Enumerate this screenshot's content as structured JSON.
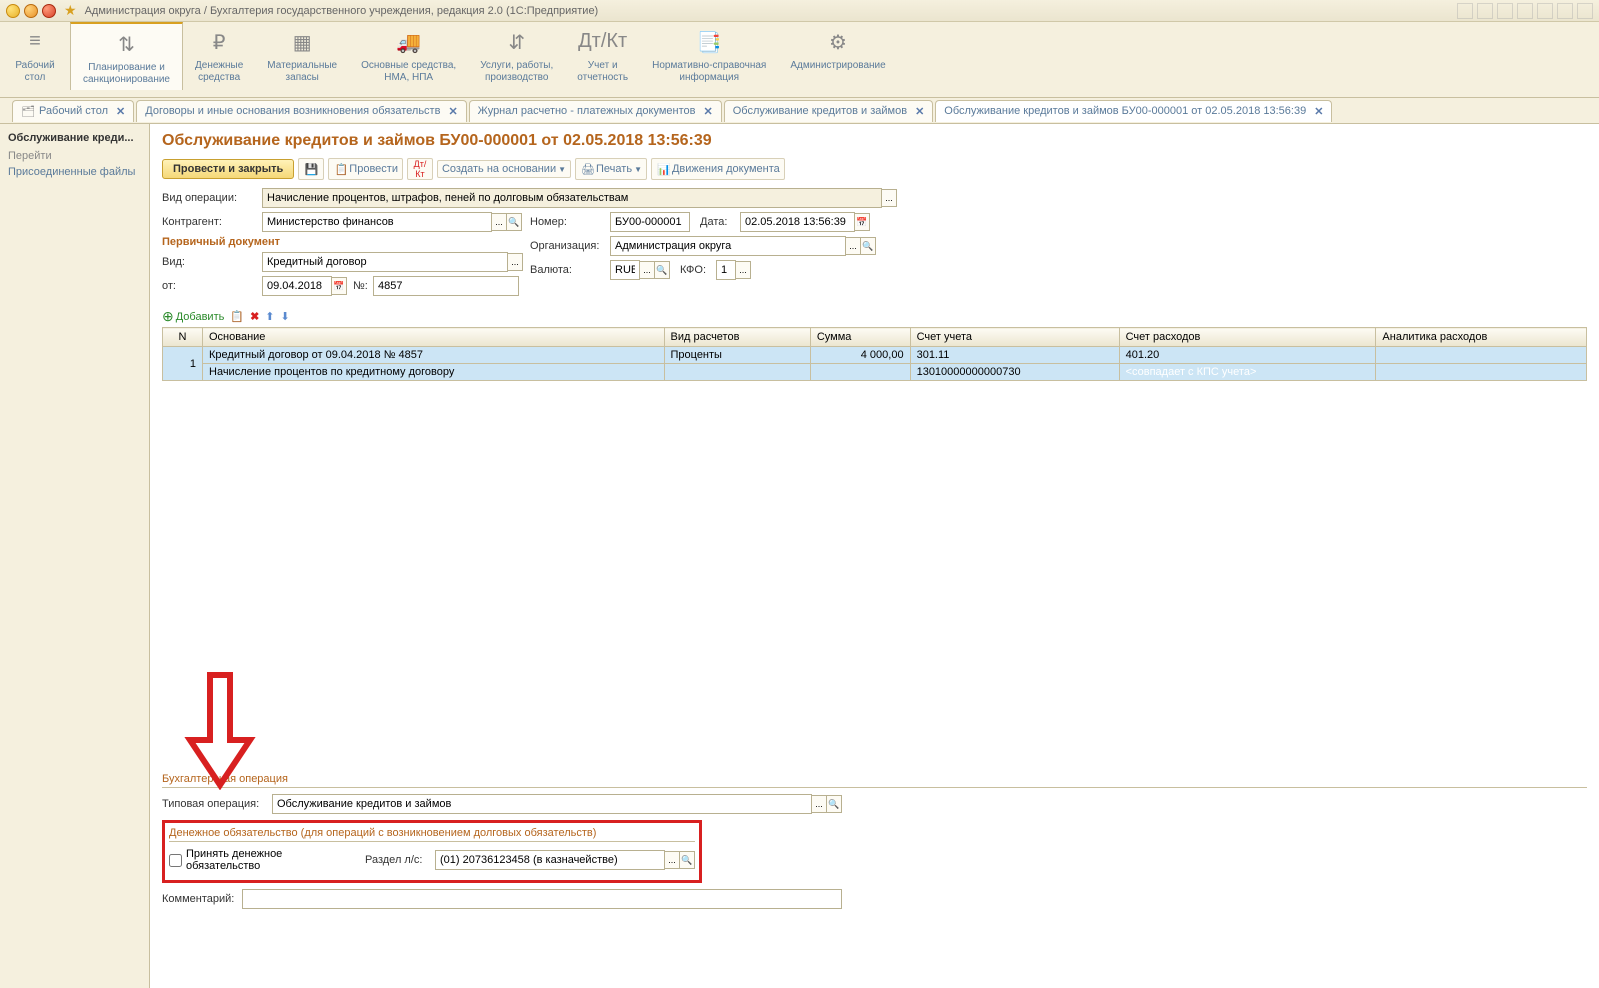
{
  "titlebar": {
    "title": "Администрация округа / Бухгалтерия государственного учреждения, редакция 2.0  (1С:Предприятие)"
  },
  "sections": [
    {
      "icon": "≡",
      "label": "Рабочий\nстол"
    },
    {
      "icon": "⇅",
      "label": "Планирование и\nсанкционирование",
      "active": true
    },
    {
      "icon": "₽",
      "label": "Денежные\nсредства"
    },
    {
      "icon": "▦",
      "label": "Материальные\nзапасы"
    },
    {
      "icon": "🚚",
      "label": "Основные средства,\nНМА, НПА"
    },
    {
      "icon": "⇵",
      "label": "Услуги, работы,\nпроизводство"
    },
    {
      "icon": "Дт/Кт",
      "label": "Учет и\nотчетность"
    },
    {
      "icon": "📑",
      "label": "Нормативно-справочная\nинформация"
    },
    {
      "icon": "⚙",
      "label": "Администрирование"
    }
  ],
  "doc_tabs": [
    {
      "icon": "🗂",
      "label": "Рабочий стол"
    },
    {
      "icon": "",
      "label": "Договоры и иные основания возникновения обязательств"
    },
    {
      "icon": "",
      "label": "Журнал расчетно - платежных документов"
    },
    {
      "icon": "",
      "label": "Обслуживание кредитов и займов"
    },
    {
      "icon": "",
      "label": "Обслуживание кредитов и займов БУ00-000001 от 02.05.2018 13:56:39",
      "active": true
    }
  ],
  "sidebar": {
    "heading": "Обслуживание креди...",
    "sub": "Перейти",
    "link": "Присоединенные файлы"
  },
  "doc": {
    "title": "Обслуживание кредитов и займов БУ00-000001 от 02.05.2018 13:56:39",
    "btn_primary": "Провести и закрыть",
    "btn_post": "Провести",
    "btn_create": "Создать на основании",
    "btn_print": "Печать",
    "btn_movements": "Движения документа",
    "op_type_label": "Вид операции:",
    "op_type": "Начисление процентов, штрафов, пеней по долговым обязательствам",
    "counterparty_label": "Контрагент:",
    "counterparty": "Министерство финансов",
    "number_label": "Номер:",
    "number": "БУ00-000001",
    "date_label": "Дата:",
    "date": "02.05.2018 13:56:39",
    "primary_doc": "Первичный документ",
    "org_label": "Организация:",
    "org": "Администрация округа",
    "kind_label": "Вид:",
    "kind": "Кредитный договор",
    "currency_label": "Валюта:",
    "currency": "RUB",
    "kfo_label": "КФО:",
    "kfo": "1",
    "from_label": "от:",
    "from_date": "09.04.2018",
    "num2_label": "№:",
    "num2": "4857",
    "add_btn": "Добавить",
    "table": {
      "headers": [
        "N",
        "Основание",
        "Вид расчетов",
        "Сумма",
        "Счет учета",
        "Счет расходов",
        "Аналитика расходов"
      ],
      "rows": [
        {
          "n": "1",
          "basis1": "Кредитный договор от 09.04.2018 № 4857",
          "basis2": "Начисление процентов по кредитному договору",
          "calc": "Проценты",
          "sum": "4 000,00",
          "acct1": "301.11",
          "acct2": "13010000000000730",
          "exp1": "401.20",
          "exp2": "<совпадает с КПС учета>"
        }
      ]
    },
    "buh_op": "Бухгалтерская операция",
    "typical_op_label": "Типовая операция:",
    "typical_op": "Обслуживание кредитов и займов",
    "money_section": "Денежное обязательство (для операций с возникновением долговых обязательств)",
    "accept_money": "Принять денежное обязательство",
    "section_label": "Раздел л/с:",
    "section_val": "(01) 20736123458 (в казначействе)",
    "comment_label": "Комментарий:"
  }
}
